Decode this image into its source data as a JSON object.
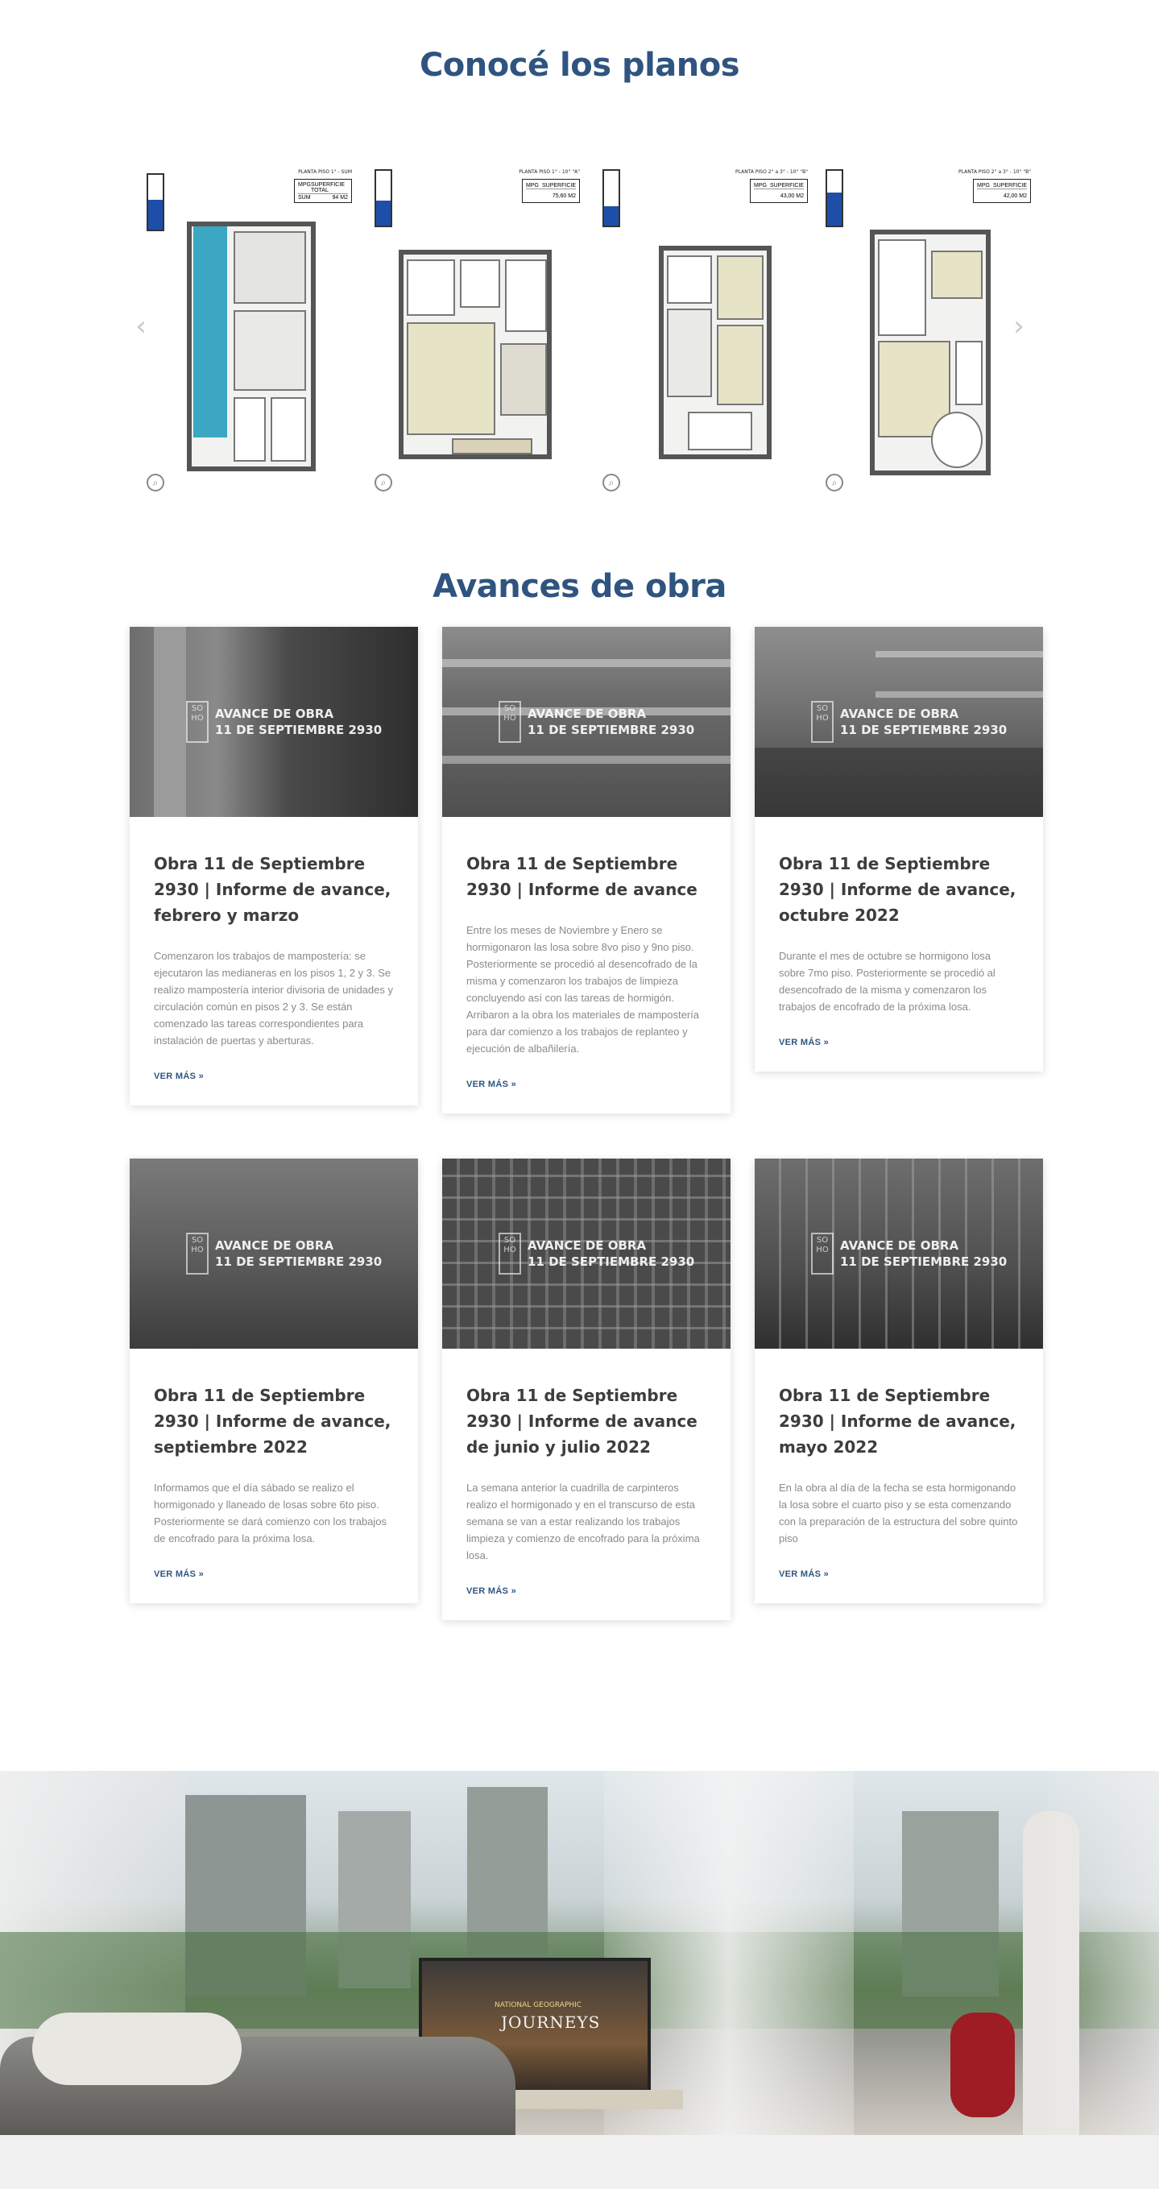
{
  "planos": {
    "title": "Conocé los planos",
    "plans": [
      {
        "header": "PLANTA PISO 1° - SUM",
        "box": [
          [
            "MPG",
            "SUPERFICIE TOTAL"
          ],
          [
            "SUM",
            "94 M2"
          ]
        ]
      },
      {
        "header": "PLANTA PISO 1° - 10° \"A\"",
        "box": [
          [
            "MPG",
            "SUPERFICIE"
          ],
          [
            "",
            "75,60 M2"
          ]
        ]
      },
      {
        "header": "PLANTA PISO 2° a 3° - 10° \"B\"",
        "box": [
          [
            "MPG",
            "SUPERFICIE"
          ],
          [
            "",
            "43,00 M2"
          ]
        ]
      },
      {
        "header": "PLANTA PISO 2° a 3° - 10° \"B\"",
        "box": [
          [
            "MPG",
            "SUPERFICIE"
          ],
          [
            "",
            "42,00 M2"
          ]
        ]
      }
    ],
    "prev_icon": "chevron-left-icon",
    "next_icon": "chevron-right-icon",
    "zoom_icon": "zoom-in-icon"
  },
  "avances": {
    "title": "Avances de obra",
    "overlay_line1": "AVANCE DE OBRA",
    "overlay_line2": "11 DE SEPTIEMBRE 2930",
    "logo_text": "SO HO",
    "posts": [
      {
        "title": "Obra 11 de Septiembre 2930 | Informe de avance, febrero y marzo",
        "excerpt": "Comenzaron los trabajos de mampostería: se ejecutaron las medianeras en los pisos 1, 2 y 3. Se realizo mampostería interior divisoria de unidades y circulación común en pisos 2 y 3. Se están comenzado las tareas correspondientes para instalación de puertas y aberturas.",
        "link": "VER MÁS »"
      },
      {
        "title": "Obra 11 de Septiembre 2930 | Informe de avance",
        "excerpt": "Entre los meses de Noviembre y Enero se hormigonaron las losa sobre 8vo piso y 9no piso. Posteriormente se procedió al desencofrado de la misma y comenzaron los trabajos de limpieza concluyendo así con las tareas de hormigón. Arribaron a la obra los materiales de mampostería para dar comienzo a los trabajos de replanteo y ejecución de albañilería.",
        "link": "VER MÁS »"
      },
      {
        "title": "Obra 11 de Septiembre 2930 | Informe de avance, octubre 2022",
        "excerpt": "Durante el mes de octubre se hormigono losa sobre 7mo piso. Posteriormente se procedió al desencofrado de la misma y comenzaron los trabajos de encofrado de la próxima losa.",
        "link": "VER MÁS »"
      },
      {
        "title": "Obra 11 de Septiembre 2930 | Informe de avance, septiembre 2022",
        "excerpt": "Informamos que el día sábado se realizo el hormigonado y llaneado de losas sobre 6to piso. Posteriormente se dará comienzo con los trabajos de encofrado para la próxima losa.",
        "link": "VER MÁS »"
      },
      {
        "title": "Obra 11 de Septiembre 2930 | Informe de avance de junio y julio 2022",
        "excerpt": "La semana anterior la cuadrilla de carpinteros realizo el hormigonado y en el transcurso de esta semana se van a estar realizando los trabajos limpieza y comienzo de encofrado para la próxima losa.",
        "link": "VER MÁS »"
      },
      {
        "title": "Obra 11 de Septiembre 2930 | Informe de avance, mayo 2022",
        "excerpt": "En la obra al día de la fecha se esta hormigonando la losa sobre el cuarto piso y se esta comenzando con la preparación de la estructura del sobre quinto piso",
        "link": "VER MÁS »"
      }
    ]
  },
  "banner": {
    "tv_brand": "NATIONAL GEOGRAPHIC",
    "tv_title": "JOURNEYS"
  }
}
